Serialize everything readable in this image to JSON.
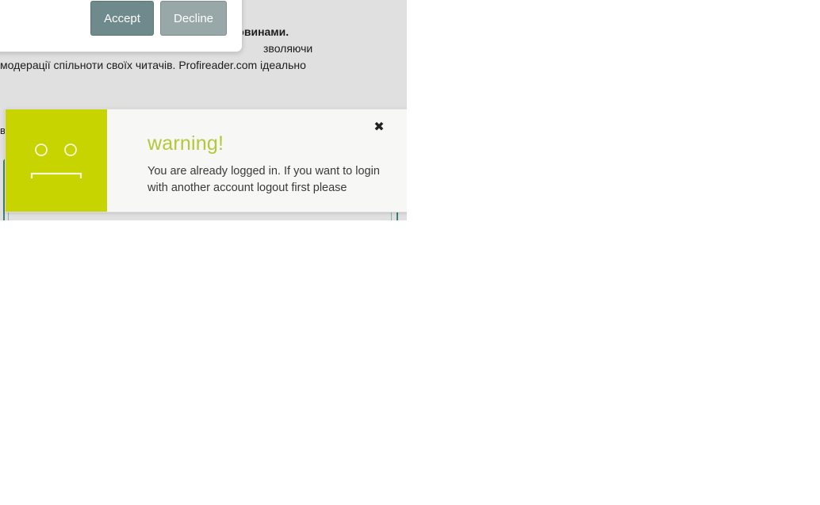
{
  "consent": {
    "accept_label": "Accept",
    "decline_label": "Decline"
  },
  "page": {
    "line1": "з новинами.",
    "line2_tail": "зволяючи",
    "line3": "модерації спільноти своїх читачів. Profireader.com ідеально",
    "edge_letter": "в"
  },
  "toast": {
    "title": "warning!",
    "message": "You are already logged in. If you want to login with another account logout first please",
    "close_icon": "close-icon",
    "face_icon": "sad-face-icon",
    "accent_color": "#c8d400",
    "title_color": "#b4c83a"
  }
}
